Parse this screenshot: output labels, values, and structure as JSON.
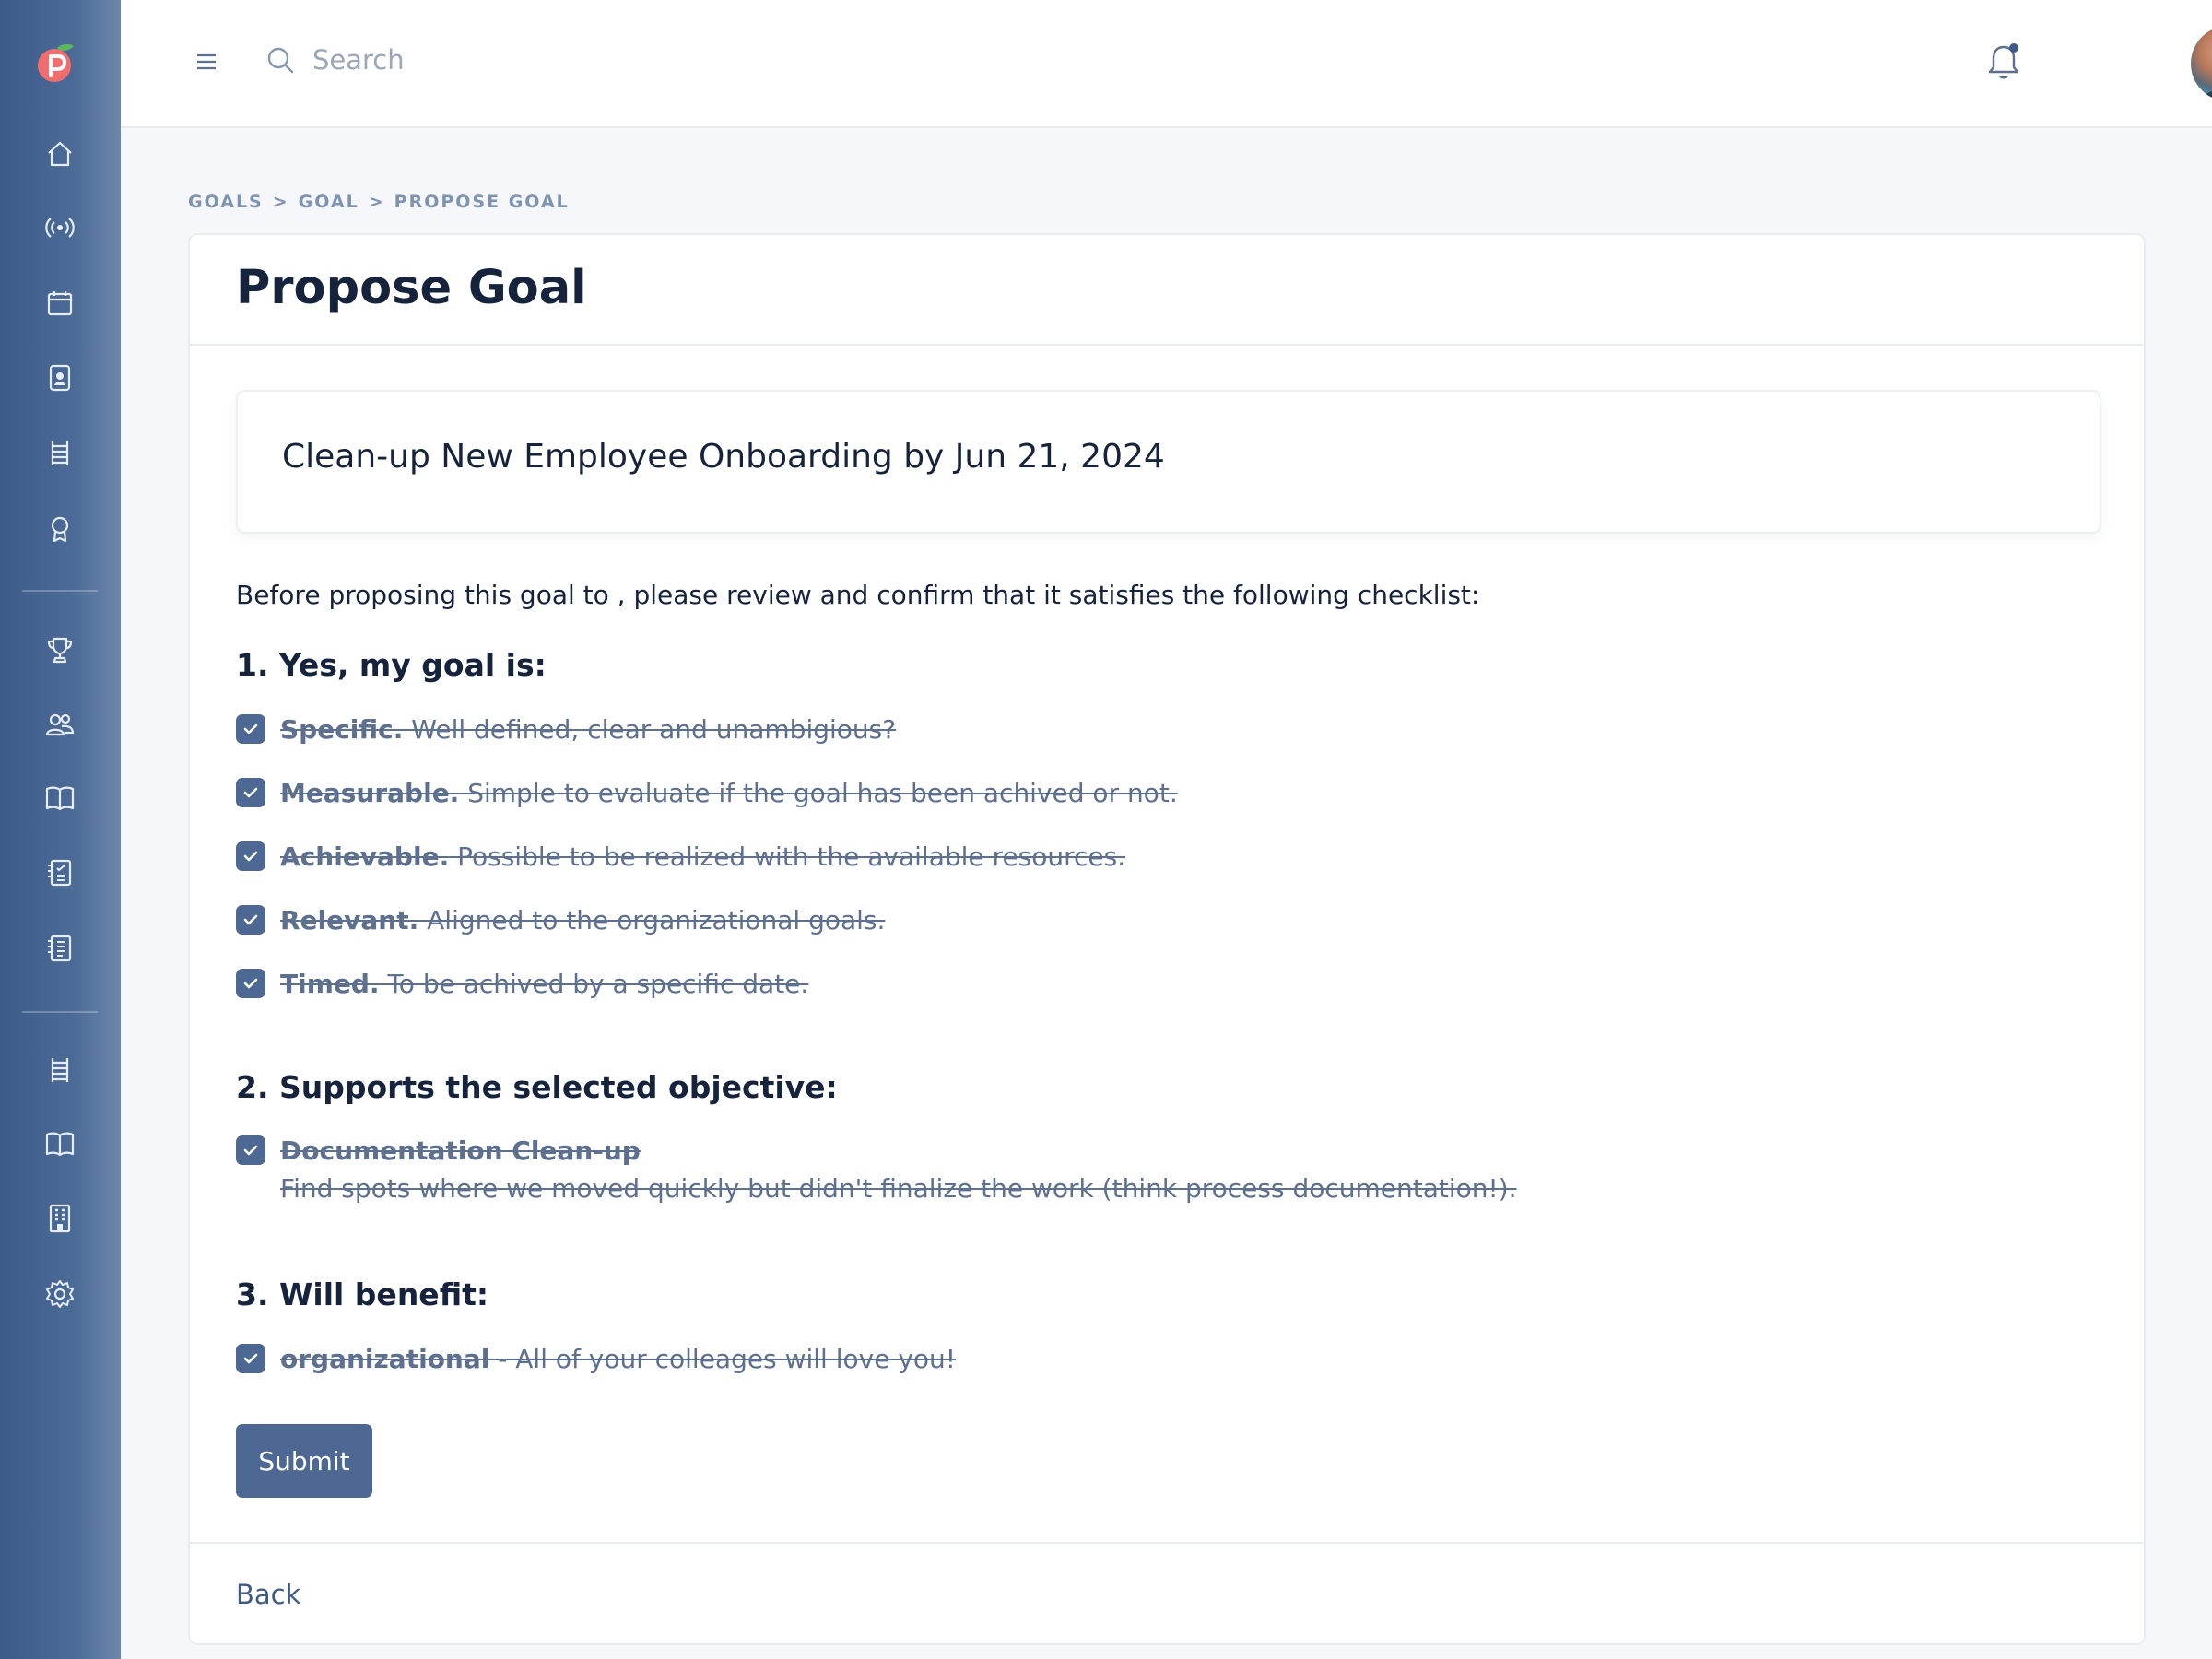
{
  "sidebar": {
    "logo": "peach-logo-icon",
    "items": [
      {
        "icon": "home-icon"
      },
      {
        "icon": "broadcast-icon"
      },
      {
        "icon": "calendar-icon"
      },
      {
        "icon": "badge-icon"
      },
      {
        "icon": "ladder-icon"
      },
      {
        "icon": "award-icon"
      },
      {
        "icon": "trophy-icon"
      },
      {
        "icon": "team-icon"
      },
      {
        "icon": "book-icon"
      },
      {
        "icon": "checklist-icon"
      },
      {
        "icon": "notes-icon"
      },
      {
        "icon": "ladder-icon"
      },
      {
        "icon": "book-icon"
      },
      {
        "icon": "building-icon"
      },
      {
        "icon": "settings-icon"
      }
    ]
  },
  "header": {
    "search_placeholder": "Search"
  },
  "breadcrumb": {
    "items": [
      "GOALS",
      "GOAL",
      "PROPOSE GOAL"
    ],
    "separator": ">"
  },
  "page": {
    "title": "Propose Goal",
    "goal": "Clean-up New Employee Onboarding by Jun 21, 2024",
    "intro": "Before proposing this goal to , please review and confirm that it satisfies the following checklist:"
  },
  "sections": {
    "s1": {
      "title": "1. Yes, my goal is:",
      "items": [
        {
          "term": "Specific.",
          "desc": " Well defined, clear and unambigious?",
          "checked": true
        },
        {
          "term": "Measurable.",
          "desc": " Simple to evaluate if the goal has been achived or not.",
          "checked": true
        },
        {
          "term": "Achievable.",
          "desc": " Possible to be realized with the available resources.",
          "checked": true
        },
        {
          "term": "Relevant.",
          "desc": " Aligned to the organizational goals.",
          "checked": true
        },
        {
          "term": "Timed.",
          "desc": " To be achived by a specific date.",
          "checked": true
        }
      ]
    },
    "s2": {
      "title": "2. Supports the selected objective:",
      "objective": "Documentation Clean-up",
      "objective_desc": "Find spots where we moved quickly but didn't finalize the work (think process documentation!).",
      "checked": true
    },
    "s3": {
      "title": "3. Will benefit:",
      "term": "organizational",
      "desc": " - All of your colleages will love you!",
      "checked": true
    }
  },
  "actions": {
    "submit": "Submit",
    "back": "Back"
  },
  "colors": {
    "sidebar": "#4b6a96",
    "accent": "#4c6893",
    "checked_text": "#5d7090",
    "breadcrumb": "#7d93b2"
  }
}
